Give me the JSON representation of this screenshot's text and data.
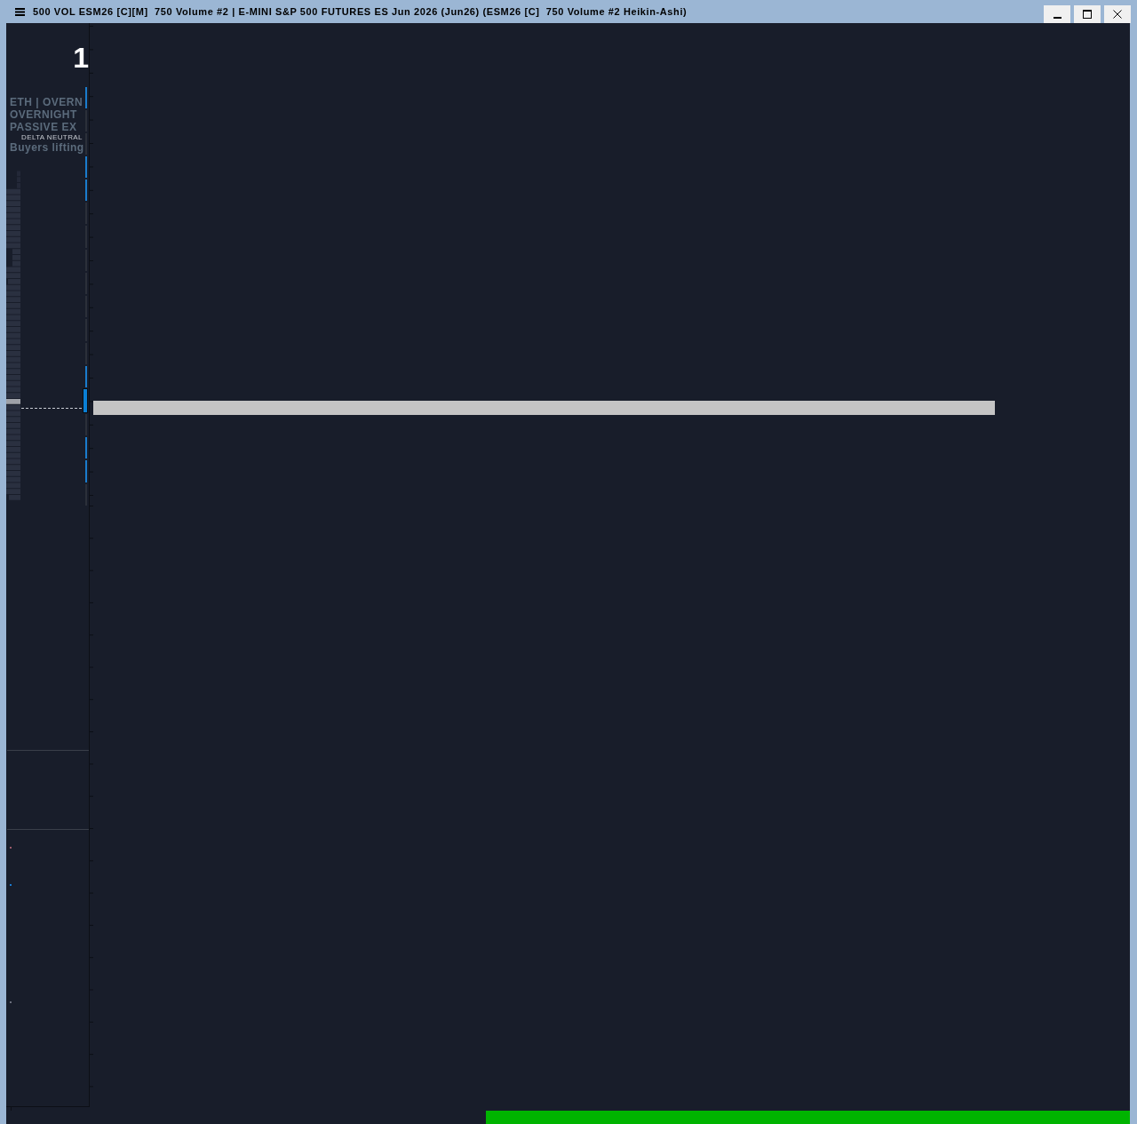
{
  "window": {
    "title": "500 VOL ESM26 [C][M]  750 Volume #2 | E-MINI S&P 500 FUTURES ES Jun 2026 (Jun26) (ESM26 [C]  750 Volume #2 Heikin-Ashi)",
    "controls": [
      {
        "kind": "minimize"
      },
      {
        "kind": "maximize"
      },
      {
        "kind": "close"
      }
    ]
  },
  "side_panel": {
    "value": "1",
    "lines": [
      {
        "kind": "label",
        "text": "ETH | OVERN"
      },
      {
        "kind": "label",
        "text": "OVERNIGHT"
      },
      {
        "kind": "label",
        "text": "PASSIVE EX"
      },
      {
        "kind": "tag",
        "text": "DELTA NEUTRAL"
      },
      {
        "kind": "label",
        "text": "Buyers lifting"
      }
    ],
    "markers": [
      {
        "color": "#9a5a6a"
      },
      {
        "color": "#1a7ad0"
      },
      {
        "color": "#6a6e7c"
      }
    ]
  }
}
